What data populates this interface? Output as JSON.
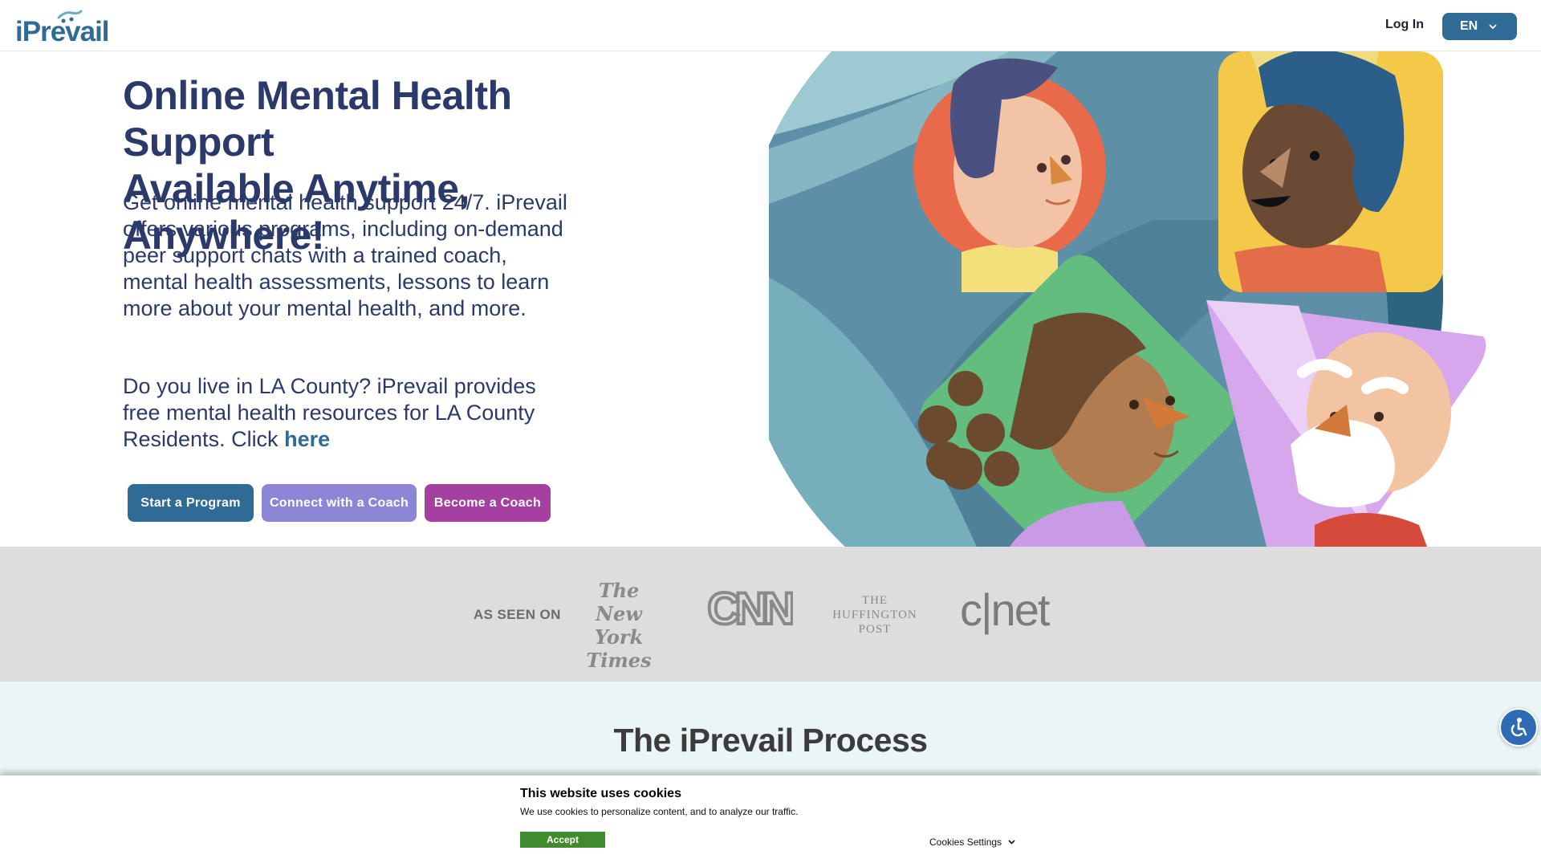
{
  "header": {
    "logo_text": "iPrevail",
    "login_label": "Log In",
    "language": "EN"
  },
  "hero": {
    "title_line1": "Online Mental Health Support",
    "title_line2": "Available Anytime, Anywhere!",
    "paragraph1": "Get online mental health support 24/7. iPrevail offers various programs, including on-demand peer support chats with a trained coach, mental health assessments, lessons to learn more about your mental health, and more.",
    "paragraph2": "Do you live in LA County? iPrevail provides free mental health resources for LA County Residents. Click",
    "paragraph2_link": "here",
    "buttons": {
      "start": "Start a Program",
      "connect": "Connect with a Coach",
      "become": "Become a Coach"
    }
  },
  "press": {
    "label": "AS SEEN ON",
    "logos": {
      "nyt_line1": "The",
      "nyt_line2": "New York",
      "nyt_line3": "Times",
      "cnn": "CNN",
      "huff_line1": "THE",
      "huff_line2": "HUFFINGTON",
      "huff_line3": "POST",
      "cnet": "c|net"
    }
  },
  "process": {
    "title": "The iPrevail Process"
  },
  "cookie": {
    "title": "This website uses cookies",
    "text": "We use cookies to personalize content, and to analyze our traffic.",
    "accept": "Accept",
    "settings": "Cookies Settings"
  },
  "colors": {
    "brand_blue": "#2f6b94",
    "lavender": "#8b87d6",
    "magenta": "#a53fa0",
    "heading_navy": "#2b3a6b",
    "accept_green": "#3f8b2e"
  },
  "icons": {
    "language_chevron": "chevron-down-icon",
    "accessibility": "accessibility-icon",
    "settings_chevron": "chevron-down-icon"
  }
}
